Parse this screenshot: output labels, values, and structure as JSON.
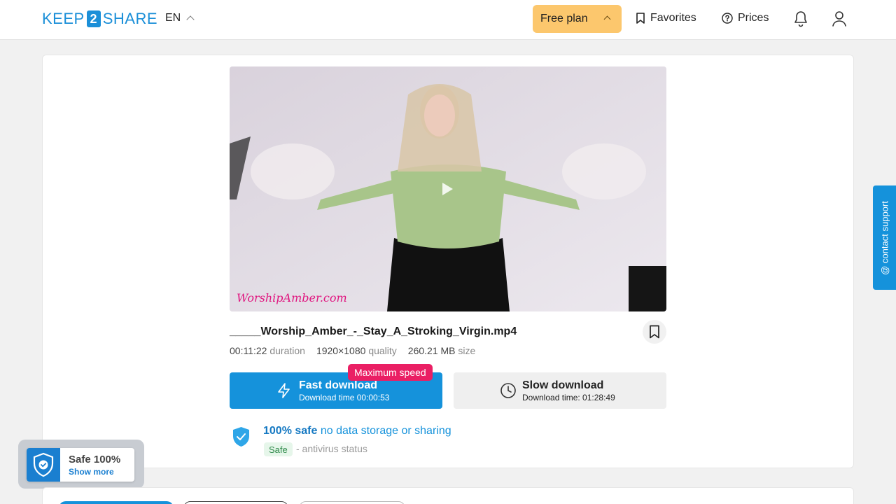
{
  "header": {
    "logo_left": "KEEP",
    "logo_mid": "2",
    "logo_right": "SHARE",
    "language": "EN",
    "free_plan_label": "Free plan",
    "favorites_label": "Favorites",
    "prices_label": "Prices"
  },
  "video": {
    "watermark": "WorshipAmber.com"
  },
  "file": {
    "name": "_____Worship_Amber_-_Stay_A_Stroking_Virgin.mp4",
    "duration_value": "00:11:22",
    "duration_label": "duration",
    "quality_value": "1920×1080",
    "quality_label": "quality",
    "size_value": "260.21 MB",
    "size_label": "size"
  },
  "download": {
    "badge": "Maximum speed",
    "fast_title": "Fast download",
    "fast_sub": "Download time 00:00:53",
    "slow_title": "Slow download",
    "slow_sub": "Download time: 01:28:49"
  },
  "safety": {
    "safe_bold": "100% safe",
    "safe_rest": " no data storage or sharing",
    "tag": "Safe",
    "antivirus": "- antivirus status"
  },
  "support": {
    "label": "@ contact support"
  },
  "safe_badge": {
    "title": "Safe 100%",
    "link": "Show more"
  },
  "colors": {
    "accent": "#1592db",
    "plan": "#fcc76d",
    "badge": "#ea1f64"
  }
}
